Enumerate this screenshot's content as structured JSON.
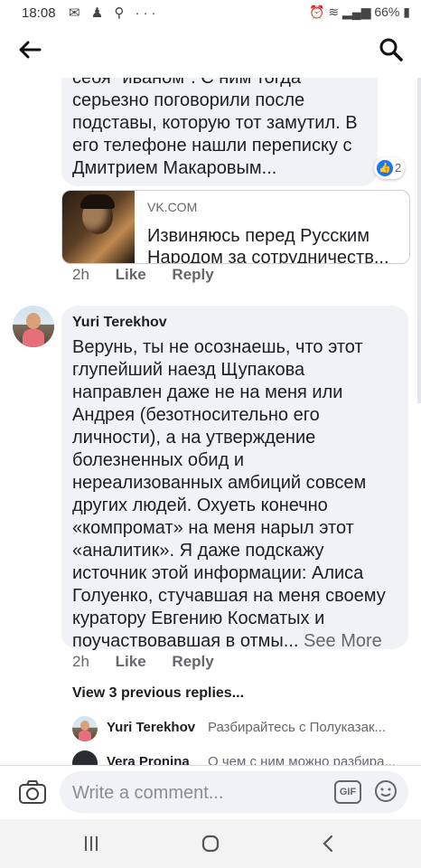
{
  "status_bar": {
    "time": "18:08",
    "battery": "66%"
  },
  "comment1": {
    "text": "себя \"иваном\". С ним тогда серьезно поговорили после подставы, которую тот замутил. В его телефоне нашли переписку с Дмитрием Макаровым...",
    "reaction_count": "2",
    "link": {
      "domain": "VK.COM",
      "title": "Извиняюсь перед Русским Народом за сотрудничеств..."
    },
    "time": "2h",
    "like": "Like",
    "reply": "Reply"
  },
  "comment2": {
    "author": "Yuri Terekhov",
    "text": "Верунь, ты не осознаешь, что этот глупейший наезд Щупакова направлен даже не на меня или Андрея (безотносительно его личности), а на утверждение болезненных обид и нереализованных амбиций совсем других людей. Охуеть конечно «компромат» на меня нарыл этот «аналитик». Я даже подскажу источник этой информации: Алиса Голуенко, стучавшая на меня своему куратору Евгению Косматых и поучаствовавшая в отмы...",
    "see_more": "See More",
    "time": "2h",
    "like": "Like",
    "reply": "Reply"
  },
  "replies": {
    "view_previous": "View 3 previous replies...",
    "items": [
      {
        "author": "Yuri Terekhov",
        "text": "Разбирайтесь с Полуказак..."
      },
      {
        "author": "Vera Pronina",
        "text": "О чем с ним можно разбира..."
      }
    ]
  },
  "composer": {
    "placeholder": "Write a comment...",
    "gif_label": "GIF"
  },
  "colors": {
    "accent": "#1877f2",
    "bubble": "#f0f2f5",
    "secondary_text": "#65676b"
  }
}
